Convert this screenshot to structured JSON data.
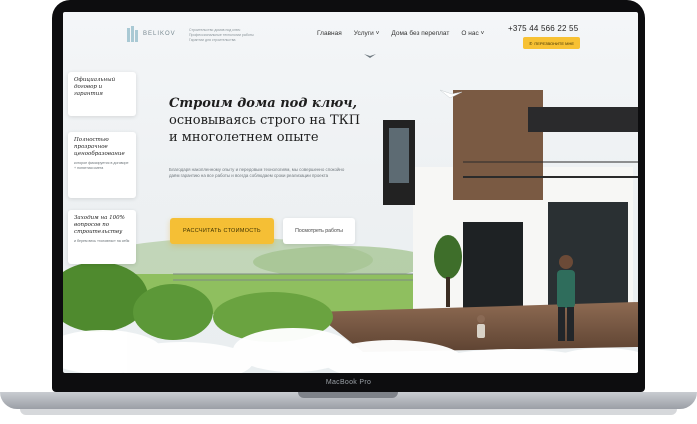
{
  "device": {
    "label": "MacBook Pro"
  },
  "header": {
    "logo_text": "BELIKOV",
    "tagline": "Строительство домов под ключ Профессиональные технологии работы Гарантии для строительства",
    "nav": [
      "Главная",
      "Услуги",
      "Дома без переплат",
      "О нас"
    ],
    "phone": "+375 44 566 22 55",
    "callback_label": "ПЕРЕЗВОНИТЕ МНЕ"
  },
  "cards": [
    {
      "title": "Официальный договор и гарантия",
      "desc": ""
    },
    {
      "title": "Полностью прозрачное ценообразование",
      "desc": "которое фиксируется в договоре + понятная смета"
    },
    {
      "title": "Заходим на 100% вопросов по строительству",
      "desc": "и берем весь «головняк» на себя"
    }
  ],
  "hero": {
    "title_em": "Строим дома под ключ,",
    "title_rest": "основываясь строго на ТКП и многолетнем опыте",
    "subtitle": "Благодаря накопленному опыту и передовым технологиям, мы совершенно спокойно даём гарантию на все работы и всегда соблюдаем сроки реализации проекта",
    "primary_button": "РАССЧИТАТЬ СТОИМОСТЬ",
    "secondary_button": "Посмотреть работы"
  },
  "colors": {
    "accent": "#f5bf35",
    "frame": "#0d0d0f"
  }
}
